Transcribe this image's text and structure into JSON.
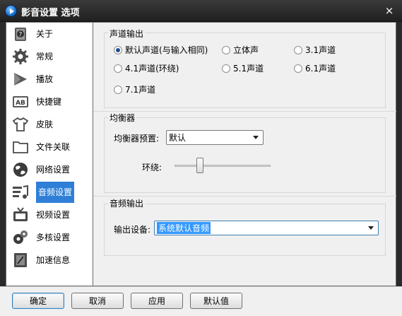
{
  "window": {
    "title": "影音设置 选项",
    "close_label": "×"
  },
  "sidebar": {
    "items": [
      {
        "label": "关于",
        "icon": "about-icon"
      },
      {
        "label": "常规",
        "icon": "gear-icon"
      },
      {
        "label": "播放",
        "icon": "play-icon"
      },
      {
        "label": "快捷键",
        "icon": "keyboard-icon"
      },
      {
        "label": "皮肤",
        "icon": "tshirt-icon"
      },
      {
        "label": "文件关联",
        "icon": "folder-icon"
      },
      {
        "label": "网络设置",
        "icon": "network-icon"
      },
      {
        "label": "音频设置",
        "icon": "audio-icon"
      },
      {
        "label": "视频设置",
        "icon": "video-icon"
      },
      {
        "label": "多核设置",
        "icon": "multicore-icon"
      },
      {
        "label": "加速信息",
        "icon": "accel-icon"
      }
    ],
    "active_index": 7
  },
  "channel_output": {
    "title": "声道输出",
    "options": [
      "默认声道(与输入相同)",
      "立体声",
      "3.1声道",
      "4.1声道(环绕)",
      "5.1声道",
      "6.1声道",
      "7.1声道"
    ],
    "selected": "默认声道(与输入相同)"
  },
  "equalizer": {
    "title": "均衡器",
    "preset_label": "均衡器预置:",
    "preset_value": "默认",
    "surround_label": "环绕:",
    "surround_level": 0.25
  },
  "audio_output": {
    "title": "音频输出",
    "device_label": "输出设备:",
    "device_value": "系统默认音频"
  },
  "buttons": {
    "ok": "确定",
    "cancel": "取消",
    "apply": "应用",
    "default": "默认值"
  },
  "colors": {
    "accent": "#2f7fd8",
    "selection": "#3399ff"
  }
}
